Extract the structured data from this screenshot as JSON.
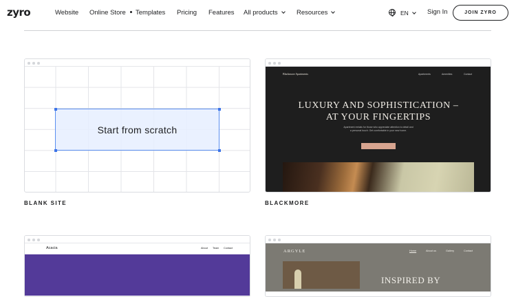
{
  "nav": {
    "logo": "zyro",
    "items": [
      {
        "label": "Website"
      },
      {
        "label": "Online Store"
      },
      {
        "label": "Templates"
      },
      {
        "label": "Pricing"
      },
      {
        "label": "Features"
      },
      {
        "label": "All products"
      },
      {
        "label": "Resources"
      }
    ],
    "language": "EN",
    "sign_in": "Sign In",
    "join": "JOIN ZYRO"
  },
  "templates": [
    {
      "title": "BLANK SITE",
      "preview_text": "Start from scratch"
    },
    {
      "title": "BLACKMORE",
      "preview": {
        "logo": "Blackmore Apartments",
        "links": [
          "Apartments",
          "Amenities",
          "Contact"
        ],
        "headline_line1": "LUXURY AND SOPHISTICATION –",
        "headline_line2": "AT YOUR FINGERTIPS",
        "body": "Apartment rentals for those who appreciate attention to detail and a personal touch. Get comfortable in your new home."
      }
    },
    {
      "preview": {
        "logo": "Acacia",
        "links": [
          "About",
          "Team",
          "Contact"
        ]
      }
    },
    {
      "preview": {
        "logo": "ARGYLE",
        "links": [
          "Home",
          "About us",
          "Gallery",
          "Contact"
        ],
        "headline": "INSPIRED BY"
      }
    }
  ]
}
